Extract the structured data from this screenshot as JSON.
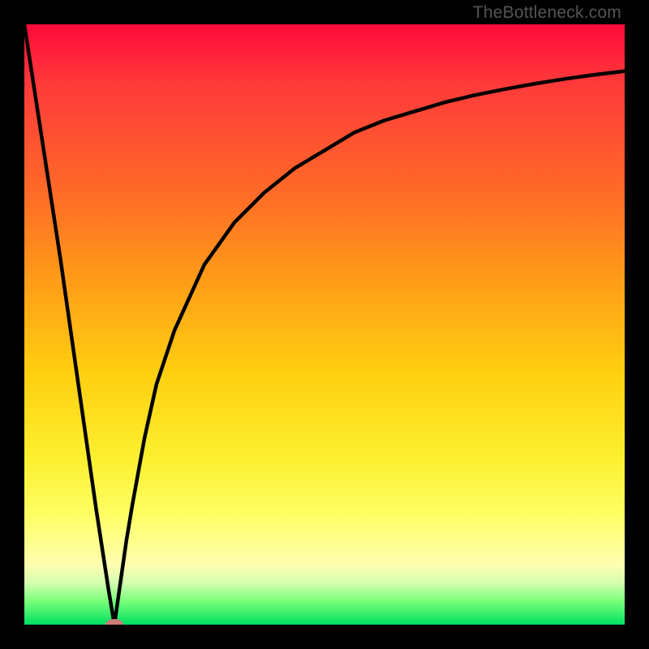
{
  "watermark": "TheBottleneck.com",
  "chart_data": {
    "type": "line",
    "title": "",
    "xlabel": "",
    "ylabel": "",
    "xlim": [
      0,
      100
    ],
    "ylim": [
      0,
      100
    ],
    "series": [
      {
        "name": "curve",
        "x": [
          0,
          2,
          4,
          6,
          8,
          10,
          12,
          14,
          15,
          16,
          17,
          18,
          20,
          22,
          25,
          30,
          35,
          40,
          45,
          50,
          55,
          60,
          65,
          70,
          75,
          80,
          85,
          90,
          95,
          100
        ],
        "values": [
          100,
          87,
          74,
          61,
          47,
          33,
          19,
          6,
          0,
          7,
          14,
          20,
          31,
          40,
          49,
          60,
          67,
          72,
          76,
          79,
          82,
          84,
          85.5,
          87,
          88.2,
          89.2,
          90.1,
          90.9,
          91.6,
          92.2
        ]
      }
    ],
    "marker": {
      "x": 15,
      "y": 0,
      "color": "#cc7a7a"
    },
    "gradient_stops": [
      {
        "pos": 0,
        "color": "#ff0a3a"
      },
      {
        "pos": 10,
        "color": "#ff3a3a"
      },
      {
        "pos": 28,
        "color": "#ff6a28"
      },
      {
        "pos": 42,
        "color": "#ff9a18"
      },
      {
        "pos": 58,
        "color": "#ffcf10"
      },
      {
        "pos": 72,
        "color": "#fcef2e"
      },
      {
        "pos": 82,
        "color": "#feff66"
      },
      {
        "pos": 90,
        "color": "#ffffaf"
      },
      {
        "pos": 93,
        "color": "#d6ffb0"
      },
      {
        "pos": 96,
        "color": "#7cff7c"
      },
      {
        "pos": 100,
        "color": "#00e060"
      }
    ]
  }
}
